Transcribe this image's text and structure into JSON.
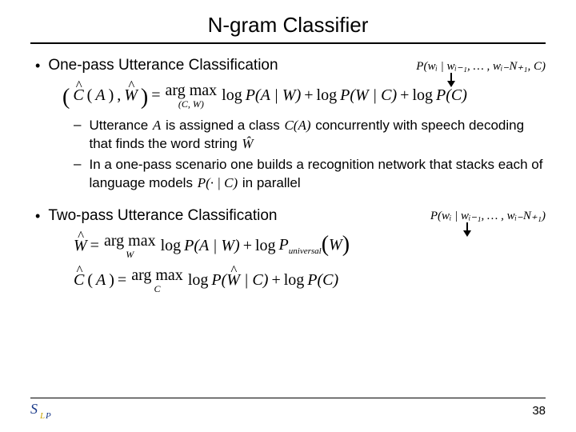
{
  "title": "N-gram Classifier",
  "section1": {
    "heading": "One-pass Utterance Classification",
    "tail_math": "P(wᵢ | wᵢ₋₁, … , wᵢ₋N₊₁, C)",
    "eq": {
      "lhs_c": "C",
      "lhs_a": "A",
      "lhs_wsep": ", ",
      "lhs_w": "W",
      "argmax_over": "(C, W)",
      "t_argmax1": "arg",
      "t_argmax2": "max",
      "t_log": "log",
      "p1_l": "P(A | W)",
      "p2_l": "P(W | C)",
      "p3_l": "P(C)"
    },
    "subs": [
      {
        "pre": "Utterance ",
        "A": "A",
        "mid1": " is assigned a class  ",
        "inl1_c": "C",
        "inl1_a": "(A)",
        "mid2": "  concurrently with speech decoding that finds the word string  ",
        "inl2": "Ŵ"
      },
      {
        "pre": "In a one-pass scenario one builds a recognition network that stacks each of language models  ",
        "inl1": "P(· | C)",
        "mid1": "  in parallel"
      }
    ]
  },
  "section2": {
    "heading": "Two-pass Utterance Classification",
    "tail_math": "P(wᵢ | wᵢ₋₁, … , wᵢ₋N₊₁)",
    "eq1": {
      "lhs_w": "W",
      "t_argmax1": "arg",
      "t_argmax2": "max",
      "argmax_over": "W",
      "t_log": "log",
      "p1": "P(A | W)",
      "p2pre": "P",
      "p2sub": "universal",
      "p2arg": "(W)"
    },
    "eq2": {
      "lhs_c": "C",
      "lhs_a": "A",
      "t_argmax1": "arg",
      "t_argmax2": "max",
      "argmax_over": "C",
      "t_log": "log",
      "p1_pre": "P(",
      "p1_w": "W",
      "p1_post": " | C)",
      "p2": "P(C)"
    }
  },
  "page_number": "38",
  "logo_text": "Sₗₚ"
}
